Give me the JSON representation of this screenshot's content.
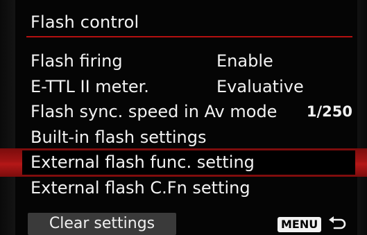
{
  "header": {
    "title": "Flash control"
  },
  "menu": {
    "items": [
      {
        "label": "Flash firing",
        "value": "Enable"
      },
      {
        "label": "E-TTL II meter.",
        "value": "Evaluative"
      },
      {
        "label": "Flash sync. speed in Av mode",
        "value": "1/250"
      },
      {
        "label": "Built-in flash settings",
        "value": ""
      },
      {
        "label": "External flash func. setting",
        "value": "",
        "selected": true
      },
      {
        "label": "External flash C.Fn setting",
        "value": ""
      }
    ]
  },
  "footer": {
    "clear_label": "Clear settings",
    "menu_badge": "MENU",
    "return_icon": "return-arrow-icon"
  },
  "colors": {
    "accent": "#b41010",
    "selection": "#a31414",
    "button_bg": "#3a3a3a"
  }
}
